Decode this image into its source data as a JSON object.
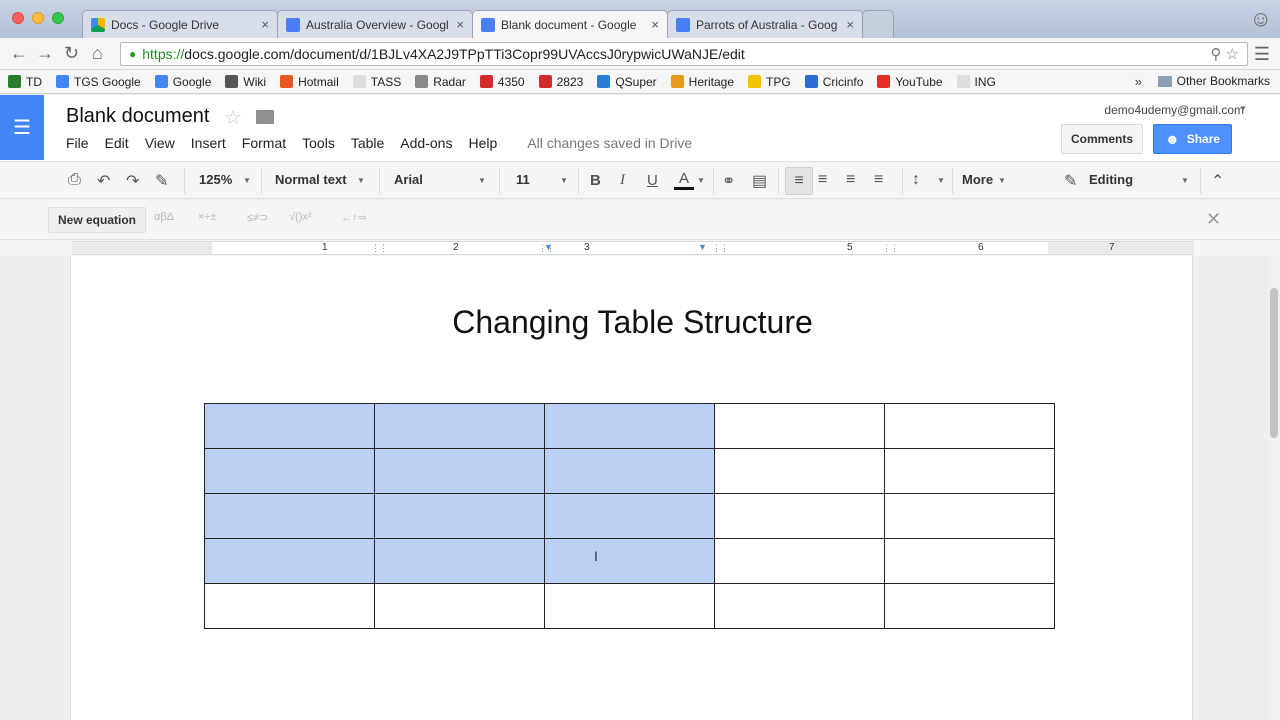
{
  "browser": {
    "tabs": [
      {
        "title": "Docs - Google Drive",
        "icon": "drive-icon"
      },
      {
        "title": "Australia Overview - Googl",
        "icon": "docs-icon"
      },
      {
        "title": "Blank document - Google",
        "icon": "docs-icon",
        "active": true
      },
      {
        "title": "Parrots of Australia - Goog",
        "icon": "docs-icon"
      }
    ],
    "tab_close": "×",
    "url_scheme": "https://",
    "url_rest": "docs.google.com/document/d/1BJLv4XA2J9TPpTTi3Copr99UVAccsJ0rypwicUWaNJE/edit",
    "bookmarks": [
      {
        "label": "TD",
        "color": "#2a7d2a"
      },
      {
        "label": "TGS Google",
        "color": "#4285f4"
      },
      {
        "label": "Google",
        "color": "#4285f4"
      },
      {
        "label": "Wiki",
        "color": "#555555"
      },
      {
        "label": "Hotmail",
        "color": "#e55a24"
      },
      {
        "label": "TASS",
        "color": "#dddddd"
      },
      {
        "label": "Radar",
        "color": "#888888"
      },
      {
        "label": "4350",
        "color": "#d22b2b"
      },
      {
        "label": "2823",
        "color": "#d22b2b"
      },
      {
        "label": "QSuper",
        "color": "#2a7dd2"
      },
      {
        "label": "Heritage",
        "color": "#e89a1b"
      },
      {
        "label": "TPG",
        "color": "#f2c200"
      },
      {
        "label": "Cricinfo",
        "color": "#2a6ad2"
      },
      {
        "label": "YouTube",
        "color": "#e52d27"
      },
      {
        "label": "ING",
        "color": "#dddddd"
      }
    ],
    "bookmarks_more": "»",
    "other_bookmarks": "Other Bookmarks"
  },
  "docs": {
    "title": "Blank document",
    "menu": [
      "File",
      "Edit",
      "View",
      "Insert",
      "Format",
      "Tools",
      "Table",
      "Add-ons",
      "Help"
    ],
    "save_status": "All changes saved in Drive",
    "account": "demo4udemy@gmail.com",
    "comments_label": "Comments",
    "share_label": "Share"
  },
  "toolbar": {
    "zoom": "125%",
    "style": "Normal text",
    "font": "Arial",
    "size": "11",
    "bold": "B",
    "italic": "I",
    "underline": "U",
    "text_color": "A",
    "more": "More",
    "mode": "Editing"
  },
  "equation": {
    "new_label": "New equation",
    "groups": [
      "αβΔ",
      "×÷±",
      "≤≠⊃",
      "√()x²",
      "←↑⇒"
    ]
  },
  "ruler": {
    "labels": [
      "1",
      "2",
      "3",
      "5",
      "6",
      "7"
    ]
  },
  "document": {
    "heading": "Changing Table Structure",
    "table": {
      "rows": 5,
      "cols": 5,
      "selected_rows": 4,
      "selected_cols": 3
    }
  },
  "colors": {
    "docs_blue": "#4285f4",
    "share_blue": "#4d90fe",
    "selection": "#bcd0f5"
  }
}
